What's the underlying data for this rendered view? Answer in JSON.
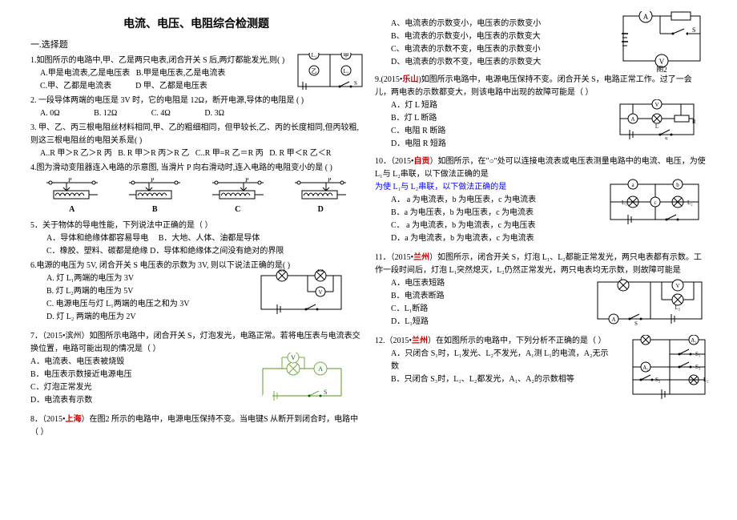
{
  "title": "电流、电压、电阻综合检测题",
  "section1": "一.选择题",
  "q1": {
    "stem": "1.如图所示的电路中,甲、乙是两只电表,闭合开关 S 后,两灯都能发光,则( )",
    "A": "A.甲是电流表,乙是电压表",
    "B": "B.甲是电压表,乙是电流表",
    "C": "C.甲、乙都是电流表",
    "D": "D 甲、乙都是电压表"
  },
  "q2": {
    "stem": "2. 一段导体两端的电压是 3V 时，它的电阻是 12Ω，断开电源,导体的电阻是 ( )",
    "A": "A. 0Ω",
    "B": "B. 12Ω",
    "C": "C. 4Ω",
    "D": "D. 3Ω"
  },
  "q3": {
    "stem": "3. 甲、乙、丙三根电阻丝材料相同,甲、乙的粗细相同，但甲较长,乙、丙的长度相同,但丙较粗,则这三根电阻丝的电阻关系是( )",
    "A": "A..R 甲＞R 乙＞R 丙",
    "B": "B. R 甲＞R 丙＞R 乙",
    "C": "C..R 甲=R 乙＝R 丙",
    "D": "D. R 甲＜R 乙＜R"
  },
  "q4": {
    "stem": "4.图为滑动变阻器连入电路的示意图, 当滑片 P 向右滑动时,连入电路的电阻变小的是 ( )",
    "labels": [
      "A",
      "B",
      "C",
      "D"
    ]
  },
  "q5": {
    "stem": "5．关于物体的导电性能，下列说法中正确的是（    ）",
    "A": "A．导体和绝缘体都容易导电",
    "B": "B．大地、人体、油都是导体",
    "C": "C．橡胶、塑料、碳都是绝缘 D．导体和绝缘体之间没有绝对的界限"
  },
  "q6": {
    "stem": "6.电源的电压为 5V, 闭合开关 S 电压表的示数为 3V, 则以下说法正确的是( )",
    "A": "A. 灯 L₁两端的电压为 3V",
    "B": "B. 灯 L₂两端的电压为 5V",
    "C": "C. 电源电压与灯 L₁两端的电压之和为 3V",
    "D": "D. 灯 L₂ 两端的电压为 2V"
  },
  "q7": {
    "src": "（2015•滨州）",
    "stem": "如图所示电路中，闭合开关 S，灯泡发光，电路正常。若将电压表与电流表交换位置，电路可能出现的情况是（    ）",
    "A": "A．电流表、电压表被烧毁",
    "B": "B．电压表示数接近电源电压",
    "C": "C．灯泡正常发光",
    "D": "D．电流表有示数"
  },
  "q8": {
    "src": "（2015•上海）",
    "srcbold": "上海",
    "stem": "在图2 所示的电路中，电源电压保持不变。当电键S 从断开到闭合时，电路中（    ）",
    "A": "A、电流表的示数变小，电压表的示数变小",
    "B": "B、电流表的示数变小，电压表的示数变大",
    "C": "C、电流表的示数不变，电压表的示数变小",
    "D": "D、电流表的示数不变，电压表的示数变大"
  },
  "q9": {
    "src": "9.(2015•乐山)",
    "srcbold": "乐山",
    "stem": "如图所示电路中，电源电压保持不变。闭合开关 S，电路正常工作。过了一会儿，两电表的示数都变大，则该电路中出现的故障可能是（    ）",
    "A": "A．灯 L 短路",
    "B": "B．灯 L 断路",
    "C": "C．电阻 R 断路",
    "D": "D．电阻 R 短路"
  },
  "q10": {
    "src": "10．（2015•自贡）",
    "srcbold": "自贡",
    "stem": "如图所示，在\"○\"处可以连接电流表或电压表测量电路中的电流、电压，为使 L₁与 L₂串联，以下做法正确的是",
    "A": "A． a 为电流表，b 为电压表，c 为电流表",
    "B": "B．a 为电压表，b 为电压表，c 为电流表",
    "C": "C． a 为电流表，b 为电流表，c 为电压表",
    "D": "D．a 为电流表，b 为电流表，c 为电流表"
  },
  "q11": {
    "src": "11．（2015•兰州）",
    "srcbold": "兰州",
    "stem": "如图所示，闭合开关 S，灯泡 L₁、L₂都能正常发光，两只电表都有示数。工作一段时间后，灯泡 L₁突然熄灭，L₂仍然正常发光，两只电表均无示数，则故障可能是",
    "A": "A．电压表短路",
    "B": "B．电流表断路",
    "C": "C．L₁断路",
    "D": "D．L₁短路"
  },
  "q12": {
    "src": "12.（2015•兰州）",
    "srcbold": "兰州",
    "stem": "在如图所示的电路中，下列分析不正确的是（    ）",
    "A": "A．只闭合 S₁时，L₁发光、L₂不发光，A₁测 L₁的电流，A₂无示数",
    "B": "B．只闭合 S₃时，L₁、L₂都发光，A₁、A₂的示数相等"
  },
  "fig2label": "图2"
}
